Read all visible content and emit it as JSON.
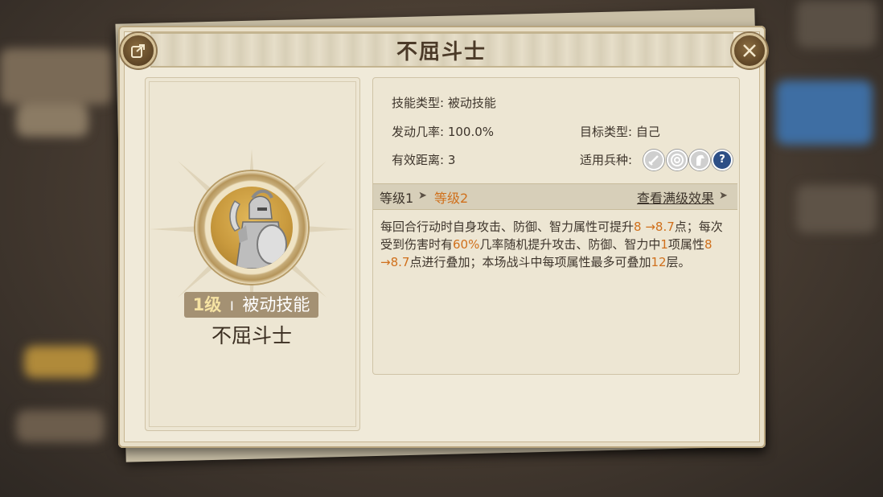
{
  "dialog": {
    "title": "不屈斗士",
    "share_icon": "share-icon",
    "close_icon": "close-icon"
  },
  "skill": {
    "level_num": "1级",
    "separator": "I",
    "type_badge": "被动技能",
    "name": "不屈斗士",
    "portrait": "spartan-warrior-icon"
  },
  "info": {
    "skill_type_label": "技能类型:",
    "skill_type_value": "被动技能",
    "trigger_rate_label": "发动几率:",
    "trigger_rate_value": "100.0%",
    "target_type_label": "目标类型:",
    "target_type_value": "自己",
    "range_label": "有效距离:",
    "range_value": "3",
    "unit_types_label": "适用兵种:",
    "unit_icons": [
      "infantry-sword-icon",
      "archer-target-icon",
      "cavalry-horse-icon",
      "help-icon"
    ]
  },
  "levels": {
    "level1": "等级1",
    "arrow": "➤",
    "level2": "等级2",
    "max_effect_link": "查看满级效果",
    "link_arrow": "➤"
  },
  "description": {
    "p1": "每回合行动时自身攻击、防御、智力属性可提升",
    "v1": "8 →8.7",
    "p2": "点；每次受到伤害时有",
    "v2": "60%",
    "p3": "几率随机提升攻击、防御、智力中",
    "v3": "1",
    "p4": "项属性",
    "v4": "8 →8.7",
    "p5": "点进行叠加；本场战斗中每项属性最多可叠加",
    "v5": "12",
    "p6": "层。"
  },
  "colors": {
    "highlight": "#d0701c",
    "panel_bg": "#f0ead9",
    "badge_bg": "#a49173"
  }
}
